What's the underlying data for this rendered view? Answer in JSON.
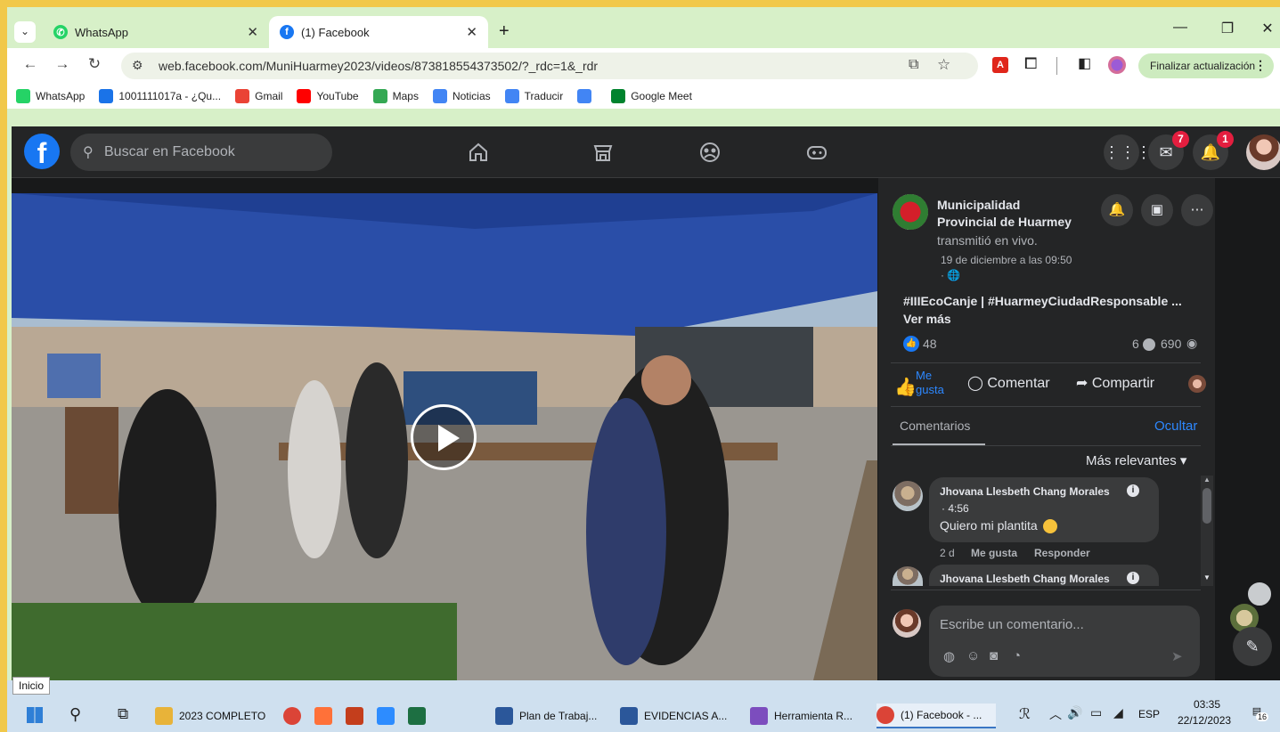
{
  "browser": {
    "tabs": [
      {
        "title": "WhatsApp",
        "active": false,
        "icon": "whatsapp-icon"
      },
      {
        "title": "(1) Facebook",
        "active": true,
        "icon": "facebook-icon"
      }
    ],
    "new_tab": "+",
    "url": "web.facebook.com/MuniHuarmey2023/videos/873818554373502/?_rdc=1&_rdr",
    "update_button": "Finalizar actualización",
    "bookmarks": [
      {
        "label": "WhatsApp",
        "icon": "whatsapp-icon",
        "color": "#25d366"
      },
      {
        "label": "1001111017a - ¿Qu...",
        "icon": "document-icon",
        "color": "#1a73e8"
      },
      {
        "label": "Gmail",
        "icon": "gmail-icon",
        "color": "#ea4335"
      },
      {
        "label": "YouTube",
        "icon": "youtube-icon",
        "color": "#ff0000"
      },
      {
        "label": "Maps",
        "icon": "maps-icon",
        "color": "#34a853"
      },
      {
        "label": "Noticias",
        "icon": "news-icon",
        "color": "#4285f4"
      },
      {
        "label": "Traducir",
        "icon": "translate-icon",
        "color": "#4285f4"
      },
      {
        "label": "",
        "icon": "google-icon",
        "color": "#4285f4"
      },
      {
        "label": "Google Meet",
        "icon": "meet-icon",
        "color": "#00832d"
      }
    ]
  },
  "facebook": {
    "search_placeholder": "Buscar en Facebook",
    "messenger_badge": "7",
    "notifications_badge": "1",
    "post": {
      "page_name_line1": "Municipalidad",
      "page_name_line2": "Provincial de Huarmey",
      "action": "transmitió en vivo.",
      "date": "19 de diciembre a las 09:50",
      "privacy": "·",
      "text": "#IIIEcoCanje | #HuarmeyCiudadResponsable ...",
      "see_more": "Ver más",
      "likes": "48",
      "comments_count": "6",
      "views": "690",
      "like_label_line1": "Me",
      "like_label_line2": "gusta",
      "comment_label": "Comentar",
      "share_label": "Compartir"
    },
    "comments_header": "Comentarios",
    "hide": "Ocultar",
    "sort": "Más relevantes",
    "comments": [
      {
        "author": "Jhovana Llesbeth Chang Morales",
        "sub": "· 4:56",
        "text": "Quiero mi plantita",
        "time": "2 d",
        "like": "Me gusta",
        "reply": "Responder"
      },
      {
        "author": "Jhovana Llesbeth Chang Morales"
      }
    ],
    "comment_placeholder": "Escribe un comentario..."
  },
  "taskbar": {
    "tooltip": "Inicio",
    "items": [
      {
        "label": "2023 COMPLETO",
        "icon": "folder-icon",
        "color": "#e8b339"
      },
      {
        "label": "",
        "icon": "chrome-icon",
        "color": "#db4437"
      },
      {
        "label": "",
        "icon": "firefox-icon",
        "color": "#ff7139"
      },
      {
        "label": "",
        "icon": "powerpoint-icon",
        "color": "#c43e1c"
      },
      {
        "label": "",
        "icon": "zoom-icon",
        "color": "#2d8cff"
      },
      {
        "label": "",
        "icon": "excel-icon",
        "color": "#1d6f42"
      },
      {
        "label": "Plan de Trabaj...",
        "icon": "word-icon",
        "color": "#2b579a"
      },
      {
        "label": "EVIDENCIAS A...",
        "icon": "word-icon",
        "color": "#2b579a"
      },
      {
        "label": "Herramienta R...",
        "icon": "snipping-icon",
        "color": "#7c4dbe"
      },
      {
        "label": "(1) Facebook - ...",
        "icon": "chrome-icon",
        "color": "#db4437"
      }
    ],
    "lang": "ESP",
    "time": "03:35",
    "date": "22/12/2023",
    "notif_count": "16"
  }
}
